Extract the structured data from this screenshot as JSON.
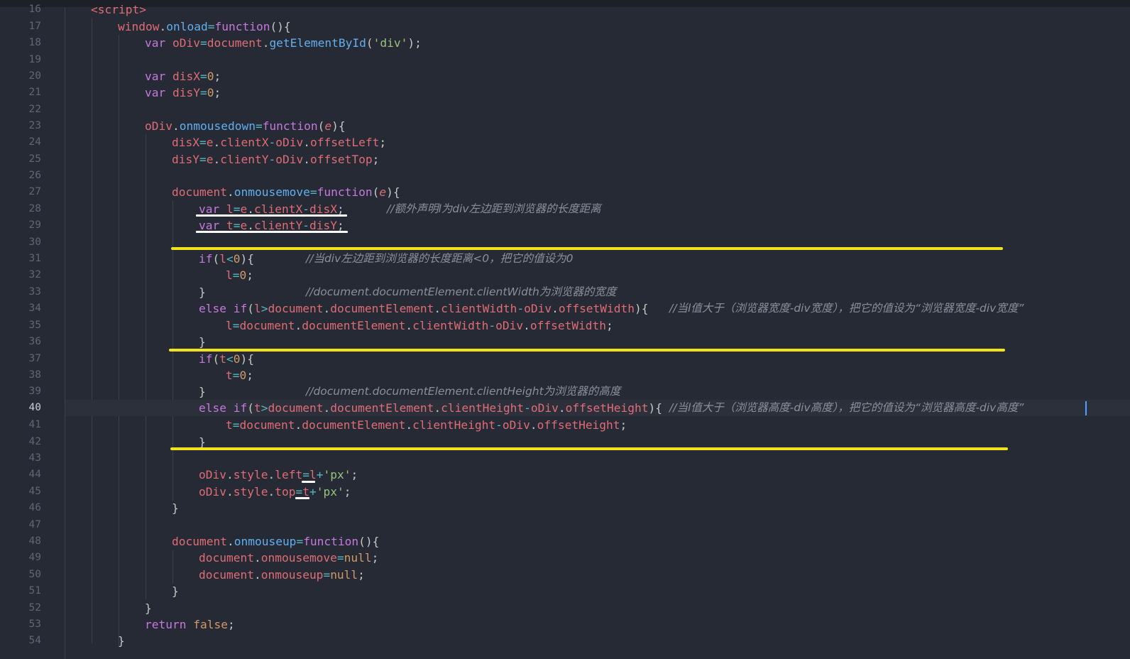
{
  "editor": {
    "language": "javascript",
    "active_line": 40,
    "lines": [
      {
        "n": "16"
      },
      {
        "n": "17"
      },
      {
        "n": "18"
      },
      {
        "n": "19"
      },
      {
        "n": "20"
      },
      {
        "n": "21"
      },
      {
        "n": "22"
      },
      {
        "n": "23"
      },
      {
        "n": "24"
      },
      {
        "n": "25"
      },
      {
        "n": "26"
      },
      {
        "n": "27"
      },
      {
        "n": "28"
      },
      {
        "n": "29"
      },
      {
        "n": "30"
      },
      {
        "n": "31"
      },
      {
        "n": "32"
      },
      {
        "n": "33"
      },
      {
        "n": "34"
      },
      {
        "n": "35"
      },
      {
        "n": "36"
      },
      {
        "n": "37"
      },
      {
        "n": "38"
      },
      {
        "n": "39"
      },
      {
        "n": "40"
      },
      {
        "n": "41"
      },
      {
        "n": "42"
      },
      {
        "n": "43"
      },
      {
        "n": "44"
      },
      {
        "n": "45"
      },
      {
        "n": "46"
      },
      {
        "n": "47"
      },
      {
        "n": "48"
      },
      {
        "n": "49"
      },
      {
        "n": "50"
      },
      {
        "n": "51"
      },
      {
        "n": "52"
      },
      {
        "n": "53"
      },
      {
        "n": "54"
      }
    ],
    "tokens": {
      "l16": "<script>",
      "l17a": "window",
      "l17b": ".",
      "l17c": "onload",
      "l17d": "=",
      "l17e": "function",
      "l17f": "(){",
      "l18a": "var ",
      "l18b": "oDiv",
      "l18c": "=",
      "l18d": "document",
      "l18e": ".",
      "l18f": "getElementById",
      "l18g": "(",
      "l18h": "'div'",
      "l18i": ");",
      "l20a": "var ",
      "l20b": "disX",
      "l20c": "=",
      "l20d": "0",
      "l20e": ";",
      "l21a": "var ",
      "l21b": "disY",
      "l21c": "=",
      "l21d": "0",
      "l21e": ";",
      "l23a": "oDiv",
      "l23b": ".",
      "l23c": "onmousedown",
      "l23d": "=",
      "l23e": "function",
      "l23f": "(",
      "l23g": "e",
      "l23h": "){",
      "l24a": "disX",
      "l24b": "=",
      "l24c": "e",
      "l24d": ".",
      "l24e": "clientX",
      "l24f": "-",
      "l24g": "oDiv",
      "l24h": ".",
      "l24i": "offsetLeft",
      "l24j": ";",
      "l25a": "disY",
      "l25b": "=",
      "l25c": "e",
      "l25d": ".",
      "l25e": "clientY",
      "l25f": "-",
      "l25g": "oDiv",
      "l25h": ".",
      "l25i": "offsetTop",
      "l25j": ";",
      "l27a": "document",
      "l27b": ".",
      "l27c": "onmousemove",
      "l27d": "=",
      "l27e": "function",
      "l27f": "(",
      "l27g": "e",
      "l27h": "){",
      "l28a": "var ",
      "l28b": "l",
      "l28c": "=",
      "l28d": "e",
      "l28e": ".",
      "l28f": "clientX",
      "l28g": "-",
      "l28h": "disX",
      "l28i": ";",
      "l28comment": "//额外声明l为div左边距到浏览器的长度距离",
      "l29a": "var ",
      "l29b": "t",
      "l29c": "=",
      "l29d": "e",
      "l29e": ".",
      "l29f": "clientY",
      "l29g": "-",
      "l29h": "disY",
      "l29i": ";",
      "l31a": "if",
      "l31b": "(",
      "l31c": "l",
      "l31d": "<",
      "l31e": "0",
      "l31f": "){",
      "l31comment": "//当div左边距到浏览器的长度距离<0，把它的值设为0",
      "l32a": "l",
      "l32b": "=",
      "l32c": "0",
      "l32d": ";",
      "l33a": "}",
      "l33comment": "//document.documentElement.clientWidth为浏览器的宽度",
      "l34a": "else ",
      "l34b": "if",
      "l34c": "(",
      "l34d": "l",
      "l34e": ">",
      "l34f": "document",
      "l34g": ".",
      "l34h": "documentElement",
      "l34i": ".",
      "l34j": "clientWidth",
      "l34k": "-",
      "l34l": "oDiv",
      "l34m": ".",
      "l34n": "offsetWidth",
      "l34o": "){",
      "l34comment": "//当l值大于（浏览器宽度-div宽度），把它的值设为“浏览器宽度-div宽度”",
      "l35a": "l",
      "l35b": "=",
      "l35c": "document",
      "l35d": ".",
      "l35e": "documentElement",
      "l35f": ".",
      "l35g": "clientWidth",
      "l35h": "-",
      "l35i": "oDiv",
      "l35j": ".",
      "l35k": "offsetWidth",
      "l35l": ";",
      "l36a": "}",
      "l37a": "if",
      "l37b": "(",
      "l37c": "t",
      "l37d": "<",
      "l37e": "0",
      "l37f": "){",
      "l38a": "t",
      "l38b": "=",
      "l38c": "0",
      "l38d": ";",
      "l39a": "}",
      "l39comment": "//document.documentElement.clientHeight为浏览器的高度",
      "l40a": "else ",
      "l40b": "if",
      "l40c": "(",
      "l40d": "t",
      "l40e": ">",
      "l40f": "document",
      "l40g": ".",
      "l40h": "documentElement",
      "l40i": ".",
      "l40j": "clientHeight",
      "l40k": "-",
      "l40l": "oDiv",
      "l40m": ".",
      "l40n": "offsetHeight",
      "l40o": "){",
      "l40comment": "//当l值大于（浏览器高度-div高度），把它的值设为“浏览器高度-div高度”",
      "l41a": "t",
      "l41b": "=",
      "l41c": "document",
      "l41d": ".",
      "l41e": "documentElement",
      "l41f": ".",
      "l41g": "clientHeight",
      "l41h": "-",
      "l41i": "oDiv",
      "l41j": ".",
      "l41k": "offsetHeight",
      "l41l": ";",
      "l42a": "}",
      "l44a": "oDiv",
      "l44b": ".",
      "l44c": "style",
      "l44d": ".",
      "l44e": "left",
      "l44f": "=",
      "l44g": "l",
      "l44h": "+",
      "l44i": "'px'",
      "l44j": ";",
      "l45a": "oDiv",
      "l45b": ".",
      "l45c": "style",
      "l45d": ".",
      "l45e": "top",
      "l45f": "=",
      "l45g": "t",
      "l45h": "+",
      "l45i": "'px'",
      "l45j": ";",
      "l46a": "}",
      "l48a": "document",
      "l48b": ".",
      "l48c": "onmouseup",
      "l48d": "=",
      "l48e": "function",
      "l48f": "(){",
      "l49a": "document",
      "l49b": ".",
      "l49c": "onmousemove",
      "l49d": "=",
      "l49e": "null",
      "l49f": ";",
      "l50a": "document",
      "l50b": ".",
      "l50c": "onmouseup",
      "l50d": "=",
      "l50e": "null",
      "l50f": ";",
      "l51a": "}",
      "l52a": "}",
      "l53a": "return ",
      "l53b": "false",
      "l53c": ";",
      "l54a": "}"
    }
  },
  "colors": {
    "background": "#262a34",
    "keyword": "#c678dd",
    "function": "#61afef",
    "property": "#e06c75",
    "string": "#98c379",
    "number": "#d19a66",
    "comment": "#8a8f9c",
    "highlight_yellow": "#f2e31a",
    "underline_white": "#ffffff"
  }
}
